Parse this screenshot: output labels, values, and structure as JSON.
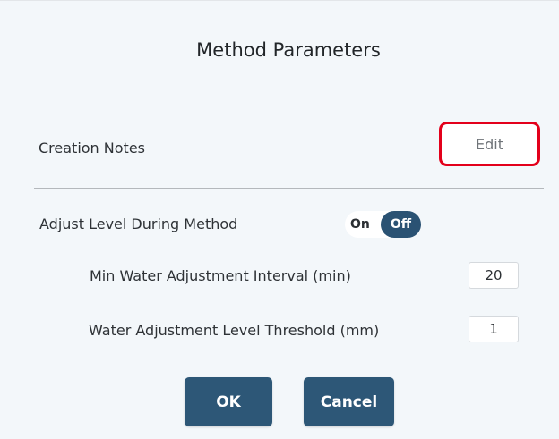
{
  "dialog": {
    "title": "Method Parameters"
  },
  "creation_notes": {
    "label": "Creation Notes",
    "edit_label": "Edit"
  },
  "adjust_level": {
    "label": "Adjust Level During Method",
    "toggle_on_label": "On",
    "toggle_off_label": "Off",
    "state": "Off"
  },
  "min_water_interval": {
    "label": "Min Water Adjustment Interval (min)",
    "value": "20"
  },
  "level_threshold": {
    "label": "Water Adjustment Level Threshold (mm)",
    "value": "1"
  },
  "actions": {
    "ok_label": "OK",
    "cancel_label": "Cancel"
  },
  "colors": {
    "primary_button": "#2d5777",
    "highlight_border": "#e3001b",
    "background": "#f3f7fa"
  }
}
